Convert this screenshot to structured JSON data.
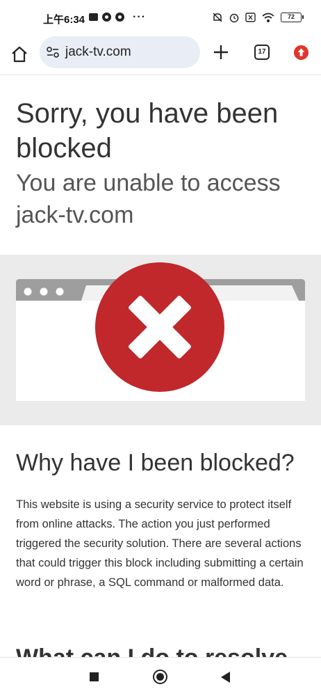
{
  "status_bar": {
    "time": "上午6:34",
    "more_indicator": "···",
    "battery": "72",
    "icons": [
      "mail-icon",
      "chrome-icon",
      "chrome-icon",
      "mute-icon",
      "alarm-icon",
      "sim-icon",
      "wifi-icon",
      "battery-icon"
    ]
  },
  "toolbar": {
    "url": "jack-tv.com",
    "tab_count": "17",
    "icons": [
      "home-icon",
      "site-info-icon",
      "new-tab-icon",
      "tabs-icon",
      "update-icon"
    ]
  },
  "page": {
    "title": "Sorry, you have been blocked",
    "subtitle": "You are unable to access jack-tv.com",
    "why_heading": "Why have I been blocked?",
    "why_text": "This website is using a security service to protect itself from online attacks. The action you just performed triggered the security solution. There are several actions that could trigger this block including submitting a certain word or phrase, a SQL command or malformed data.",
    "next_heading": "What can I do to resolve this?"
  },
  "colors": {
    "error_red": "#c0282b",
    "band_gray": "#ebebeb",
    "browser_bar_gray": "#9e9e9e",
    "url_pill": "#e9eef6"
  },
  "nav_bar": {
    "icons": [
      "recents-icon",
      "home-icon",
      "back-icon"
    ]
  }
}
